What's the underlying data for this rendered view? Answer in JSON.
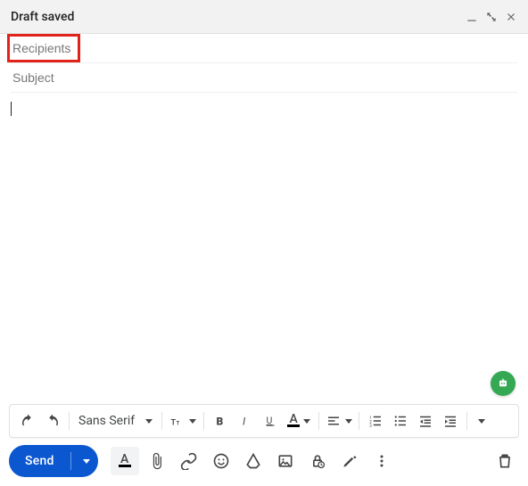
{
  "header": {
    "title": "Draft saved"
  },
  "fields": {
    "recipients_placeholder": "Recipients",
    "subject_placeholder": "Subject",
    "body_value": ""
  },
  "toolbar": {
    "font_family": "Sans Serif"
  },
  "actions": {
    "send_label": "Send"
  },
  "annotation": {
    "highlight_target": "recipients-field"
  }
}
